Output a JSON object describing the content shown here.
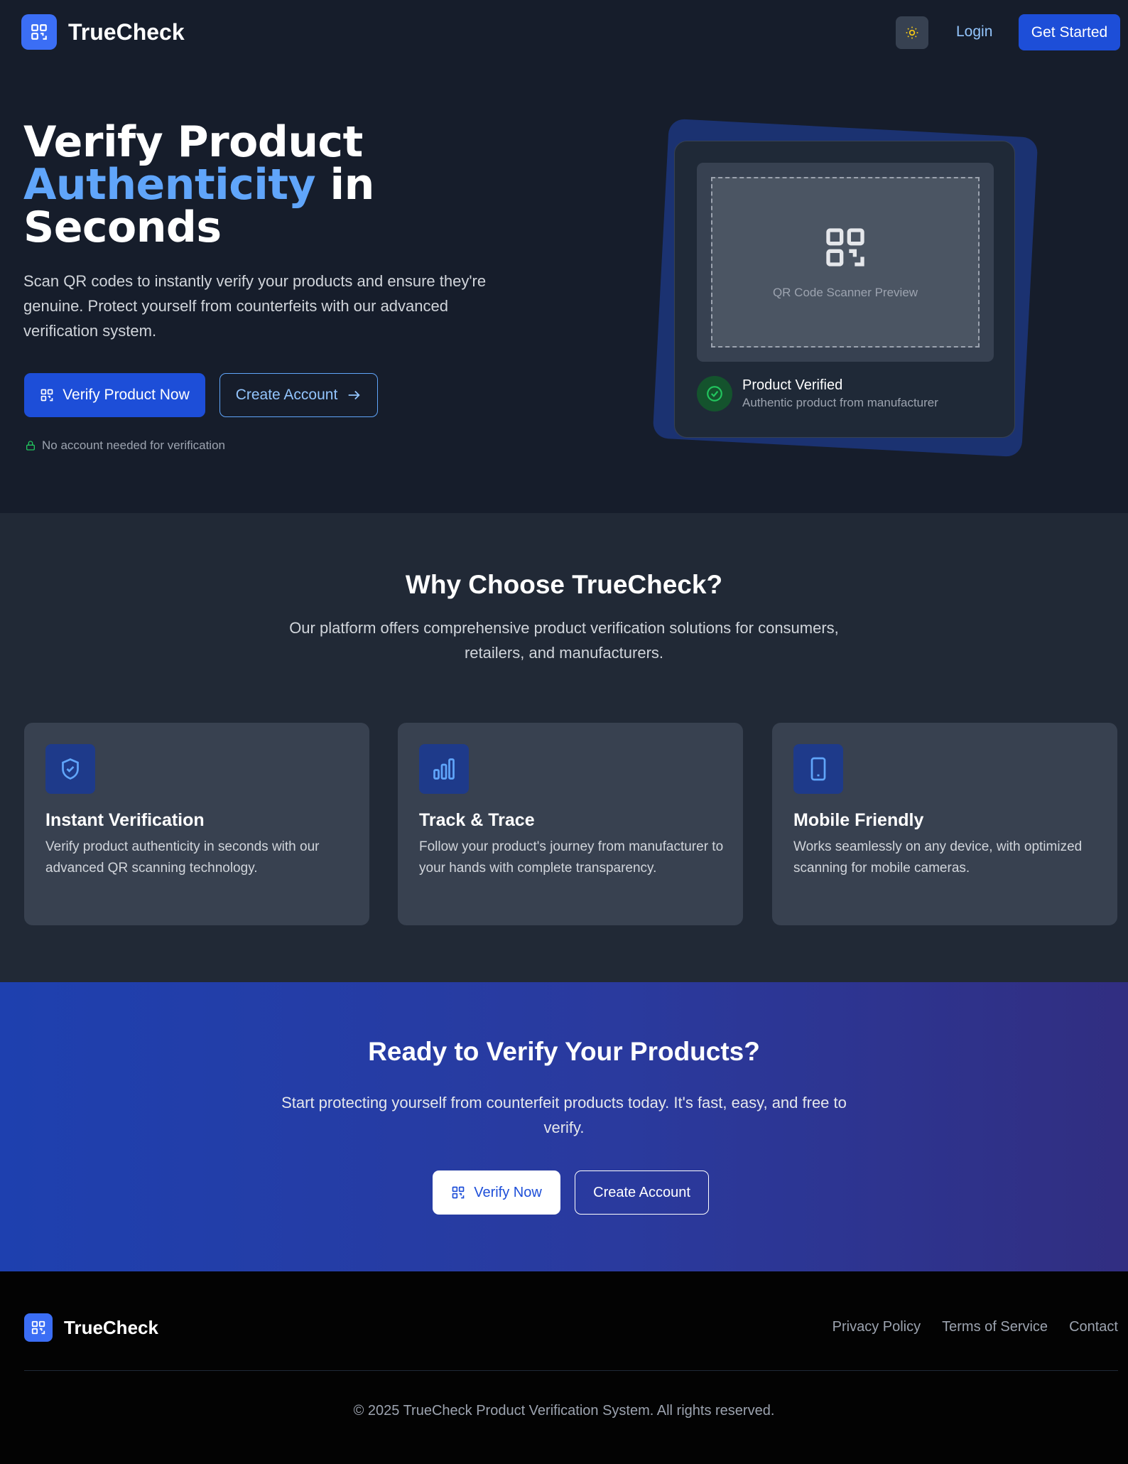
{
  "header": {
    "brand": "TrueCheck",
    "login": "Login",
    "get_started": "Get Started"
  },
  "hero": {
    "title_line1": "Verify Product",
    "title_accent": "Authenticity",
    "title_mid": " in",
    "title_line3": "Seconds",
    "description": "Scan QR codes to instantly verify your products and ensure they're genuine. Protect yourself from counterfeits with our advanced verification system.",
    "primary_button": "Verify Product Now",
    "secondary_button": "Create Account",
    "note": "No account needed for verification",
    "preview": {
      "scanner_label": "QR Code Scanner Preview",
      "status_title": "Product Verified",
      "status_subtitle": "Authentic product from manufacturer"
    }
  },
  "features": {
    "title": "Why Choose TrueCheck?",
    "subtitle": "Our platform offers comprehensive product verification solutions for consumers, retailers, and manufacturers.",
    "items": [
      {
        "icon": "shield-check-icon",
        "title": "Instant Verification",
        "description": "Verify product authenticity in seconds with our advanced QR scanning technology."
      },
      {
        "icon": "bar-chart-icon",
        "title": "Track & Trace",
        "description": "Follow your product's journey from manufacturer to your hands with complete transparency."
      },
      {
        "icon": "smartphone-icon",
        "title": "Mobile Friendly",
        "description": "Works seamlessly on any device, with optimized scanning for mobile cameras."
      }
    ]
  },
  "cta": {
    "title": "Ready to Verify Your Products?",
    "subtitle": "Start protecting yourself from counterfeit products today. It's fast, easy, and free to verify.",
    "verify_button": "Verify Now",
    "create_button": "Create Account"
  },
  "footer": {
    "brand": "TrueCheck",
    "links": [
      "Privacy Policy",
      "Terms of Service",
      "Contact"
    ],
    "copyright": "© 2025 TrueCheck Product Verification System. All rights reserved."
  },
  "colors": {
    "brand_blue": "#1d4ed8",
    "accent_blue": "#60a5fa",
    "success_green": "#22c55e",
    "background": "#161d2b"
  }
}
